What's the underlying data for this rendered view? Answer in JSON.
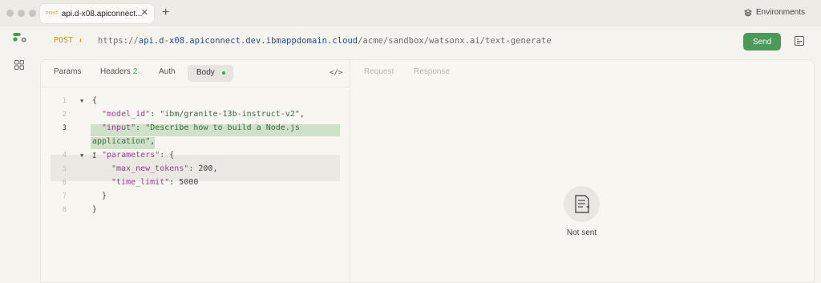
{
  "window": {
    "tab": {
      "method": "POST",
      "title": "api.d-x08.apiconnect...",
      "close": "✕"
    },
    "new_tab": "+",
    "environments_label": "Environments"
  },
  "request": {
    "method": "POST",
    "url_protocol": "https://",
    "url_host": "api.d-x08.apiconnect.dev.ibmappdomain.cloud",
    "url_path": "/acme/sandbox/watsonx.ai/text-generate",
    "send_label": "Send"
  },
  "tabs": {
    "params": "Params",
    "headers": "Headers",
    "headers_count": "2",
    "auth": "Auth",
    "body": "Body",
    "code_toggle": "</>"
  },
  "editor": {
    "line_numbers": [
      "1",
      "2",
      "3",
      "4",
      "5",
      "6",
      "7",
      "8"
    ],
    "lines": [
      {
        "open": "{"
      },
      {
        "key": "\"model_id\"",
        "sep": ": ",
        "value": "\"ibm/granite-13b-instruct-v2\"",
        "end": ","
      },
      {
        "key": "\"input\"",
        "sep": ": ",
        "value": "\"Describe how to build a Node.js",
        "wrap": "application\"",
        "end": ","
      },
      {
        "key": "\"parameters\"",
        "sep": ": ",
        "open": "{"
      },
      {
        "key": "\"max_new_tokens\"",
        "sep": ": ",
        "value": "200",
        "end": ","
      },
      {
        "key": "\"time_limit\"",
        "sep": ": ",
        "value": "5000"
      },
      {
        "close": "}"
      },
      {
        "close": "}"
      }
    ]
  },
  "response_panel": {
    "request_tab": "Request",
    "response_tab": "Response",
    "status": "Not sent"
  }
}
